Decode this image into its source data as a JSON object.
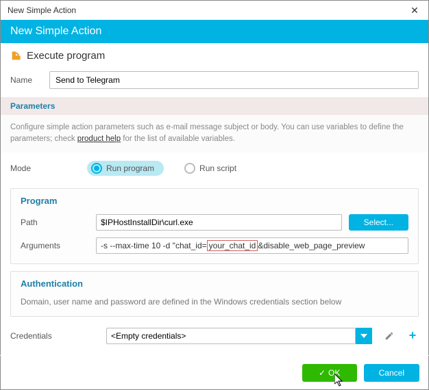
{
  "window": {
    "title": "New Simple Action"
  },
  "header": {
    "title": "New Simple Action"
  },
  "subheader": {
    "title": "Execute program"
  },
  "name": {
    "label": "Name",
    "value": "Send to Telegram"
  },
  "parameters": {
    "title": "Parameters",
    "desc_before": "Configure simple action parameters such as e-mail message subject or body. You can use variables to define the parameters; check ",
    "desc_link": "product help",
    "desc_after": " for the list of available variables."
  },
  "mode": {
    "label": "Mode",
    "run_program": "Run program",
    "run_script": "Run script"
  },
  "program": {
    "title": "Program",
    "path_label": "Path",
    "path_value": "$IPHostInstallDir\\curl.exe",
    "select_btn": "Select...",
    "args_label": "Arguments",
    "args_prefix": "-s --max-time 10 -d \"chat_id=",
    "args_highlight": "your_chat_id",
    "args_suffix": "&disable_web_page_preview"
  },
  "auth": {
    "title": "Authentication",
    "desc": "Domain, user name and password are defined in the Windows credentials section below"
  },
  "credentials": {
    "label": "Credentials",
    "value": "<Empty credentials>"
  },
  "buttons": {
    "ok": "OK",
    "cancel": "Cancel"
  }
}
